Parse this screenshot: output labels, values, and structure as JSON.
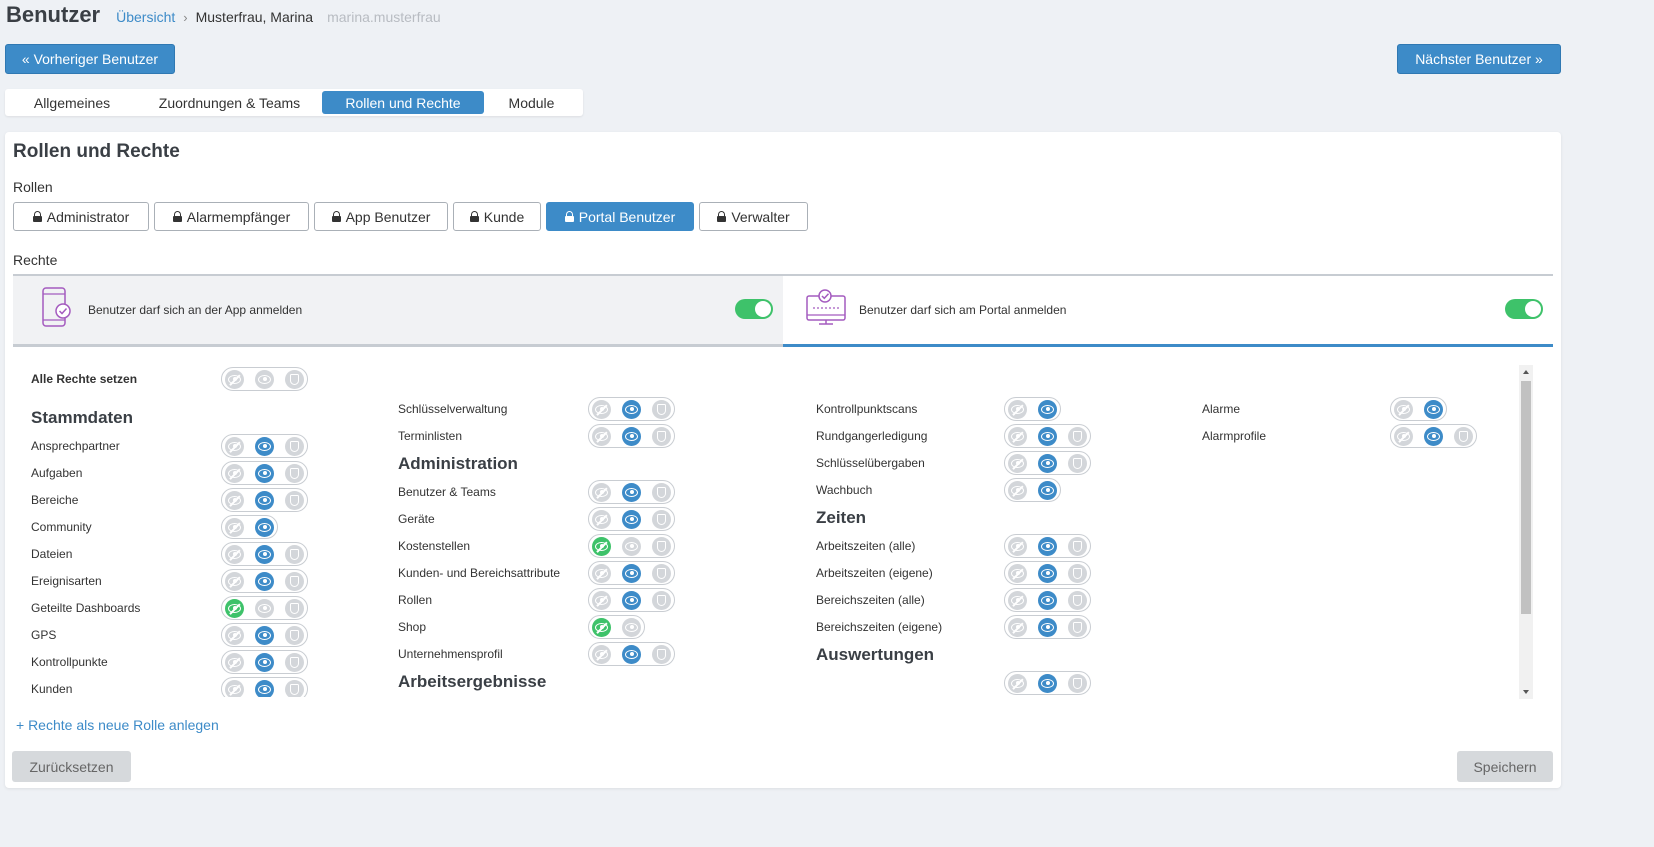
{
  "header": {
    "title": "Benutzer",
    "breadcrumb_link": "Übersicht",
    "breadcrumb_name": "Musterfrau, Marina",
    "breadcrumb_login": "marina.musterfrau"
  },
  "nav": {
    "prev_label": "« Vorheriger Benutzer",
    "next_label": "Nächster Benutzer »"
  },
  "tabs": [
    {
      "label": "Allgemeines",
      "active": false
    },
    {
      "label": "Zuordnungen & Teams",
      "active": false
    },
    {
      "label": "Rollen und Rechte",
      "active": true
    },
    {
      "label": "Module",
      "active": false
    }
  ],
  "card": {
    "title": "Rollen und Rechte",
    "roles_label": "Rollen",
    "rights_label": "Rechte"
  },
  "roles": [
    {
      "label": "Administrator",
      "active": false
    },
    {
      "label": "Alarmempfänger",
      "active": false
    },
    {
      "label": "App Benutzer",
      "active": false
    },
    {
      "label": "Kunde",
      "active": false
    },
    {
      "label": "Portal Benutzer",
      "active": true
    },
    {
      "label": "Verwalter",
      "active": false
    }
  ],
  "login": {
    "app_text": "Benutzer darf sich an der App anmelden",
    "app_enabled": true,
    "portal_text": "Benutzer darf sich am Portal anmelden",
    "portal_enabled": true
  },
  "all_rights_label": "Alle Rechte setzen",
  "columns": [
    [
      {
        "type": "heading",
        "label": "Stammdaten"
      },
      {
        "type": "row",
        "label": "Ansprechpartner",
        "state": "view",
        "shield": true
      },
      {
        "type": "row",
        "label": "Aufgaben",
        "state": "view",
        "shield": true
      },
      {
        "type": "row",
        "label": "Bereiche",
        "state": "view",
        "shield": true
      },
      {
        "type": "row",
        "label": "Community",
        "state": "view",
        "shield": false
      },
      {
        "type": "row",
        "label": "Dateien",
        "state": "view",
        "shield": true
      },
      {
        "type": "row",
        "label": "Ereignisarten",
        "state": "view",
        "shield": true
      },
      {
        "type": "row",
        "label": "Geteilte Dashboards",
        "state": "hide",
        "shield": true
      },
      {
        "type": "row",
        "label": "GPS",
        "state": "view",
        "shield": true
      },
      {
        "type": "row",
        "label": "Kontrollpunkte",
        "state": "view",
        "shield": true
      },
      {
        "type": "row",
        "label": "Kunden",
        "state": "view",
        "shield": true
      }
    ],
    [
      {
        "type": "row",
        "label": "Schlüsselverwaltung",
        "state": "view",
        "shield": true
      },
      {
        "type": "row",
        "label": "Terminlisten",
        "state": "view",
        "shield": true
      },
      {
        "type": "heading",
        "label": "Administration"
      },
      {
        "type": "row",
        "label": "Benutzer & Teams",
        "state": "view",
        "shield": true
      },
      {
        "type": "row",
        "label": "Geräte",
        "state": "view",
        "shield": true
      },
      {
        "type": "row",
        "label": "Kostenstellen",
        "state": "hide",
        "shield": true
      },
      {
        "type": "row",
        "label": "Kunden- und Bereichsattribute",
        "state": "view",
        "shield": true
      },
      {
        "type": "row",
        "label": "Rollen",
        "state": "view",
        "shield": true
      },
      {
        "type": "row",
        "label": "Shop",
        "state": "hide",
        "shield": false
      },
      {
        "type": "row",
        "label": "Unternehmensprofil",
        "state": "view",
        "shield": true
      },
      {
        "type": "heading",
        "label": "Arbeitsergebnisse"
      }
    ],
    [
      {
        "type": "row",
        "label": "Kontrollpunktscans",
        "state": "view",
        "shield": false
      },
      {
        "type": "row",
        "label": "Rundgangerledigung",
        "state": "view",
        "shield": true
      },
      {
        "type": "row",
        "label": "Schlüsselübergaben",
        "state": "view",
        "shield": true
      },
      {
        "type": "row",
        "label": "Wachbuch",
        "state": "view",
        "shield": false
      },
      {
        "type": "heading",
        "label": "Zeiten"
      },
      {
        "type": "row",
        "label": "Arbeitszeiten (alle)",
        "state": "view",
        "shield": true
      },
      {
        "type": "row",
        "label": "Arbeitszeiten (eigene)",
        "state": "view",
        "shield": true
      },
      {
        "type": "row",
        "label": "Bereichszeiten (alle)",
        "state": "view",
        "shield": true
      },
      {
        "type": "row",
        "label": "Bereichszeiten (eigene)",
        "state": "view",
        "shield": true
      },
      {
        "type": "heading",
        "label": "Auswertungen"
      },
      {
        "type": "row",
        "label": "",
        "state": "view",
        "shield": true
      }
    ],
    [
      {
        "type": "row",
        "label": "Alarme",
        "state": "view",
        "shield": false
      },
      {
        "type": "row",
        "label": "Alarmprofile",
        "state": "view",
        "shield": true
      }
    ]
  ],
  "footer": {
    "add_role_link": "+ Rechte als neue Rolle anlegen",
    "reset_label": "Zurücksetzen",
    "save_label": "Speichern"
  },
  "colors": {
    "accent": "#3d8bc8",
    "toggle_on": "#3ec26a",
    "inactive": "#d3d6da"
  }
}
